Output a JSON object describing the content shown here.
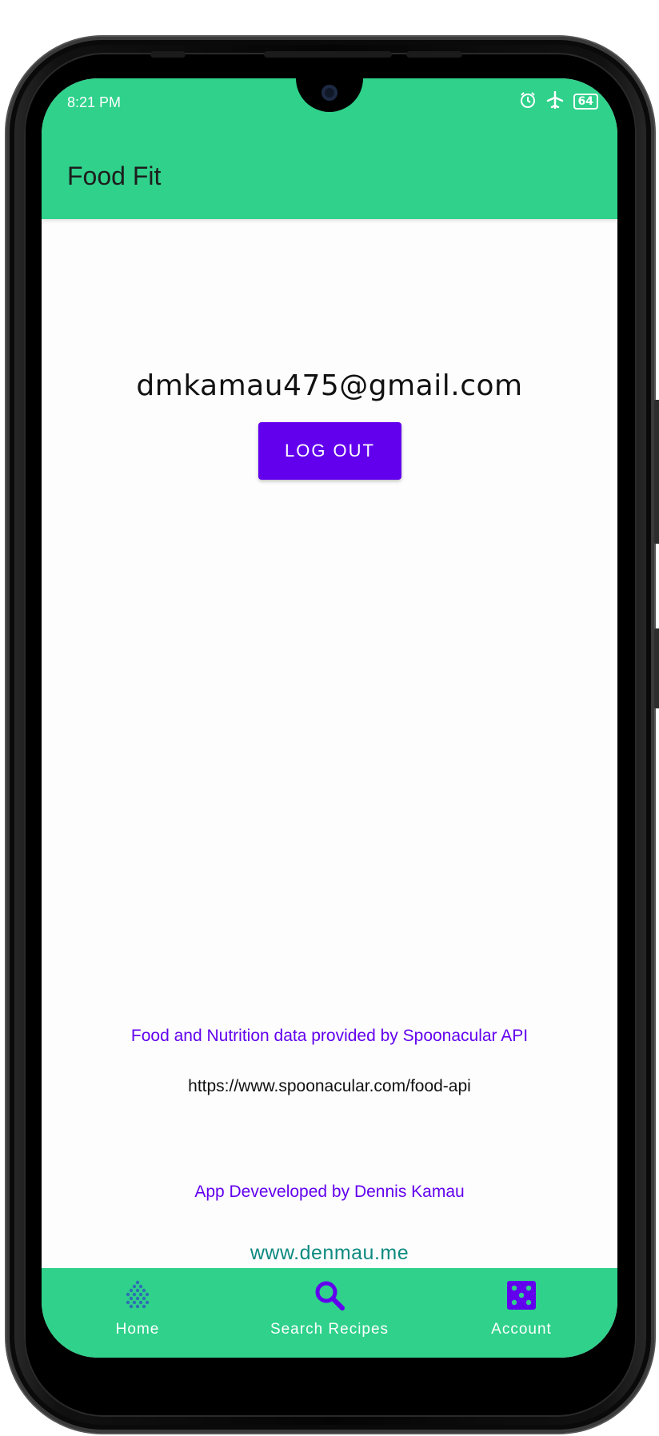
{
  "status_bar": {
    "time": "8:21 PM",
    "battery": "64"
  },
  "app_bar": {
    "title": "Food Fit"
  },
  "account": {
    "email": "dmkamau475@gmail.com",
    "logout_label": "LOG OUT"
  },
  "credits": {
    "api_text": "Food and Nutrition data provided by Spoonacular API",
    "api_url": "https://www.spoonacular.com/food-api",
    "developer_text": "App Deveveloped by Dennis Kamau",
    "website": "www.denmau.me"
  },
  "bottom_nav": {
    "items": [
      {
        "label": "Home",
        "icon": "diamond-dots-icon"
      },
      {
        "label": "Search Recipes",
        "icon": "search-icon"
      },
      {
        "label": "Account",
        "icon": "dice-icon"
      }
    ],
    "selected": "Account"
  },
  "colors": {
    "primary": "#2fd18b",
    "accent": "#6200ee",
    "link": "#0d8a80"
  }
}
